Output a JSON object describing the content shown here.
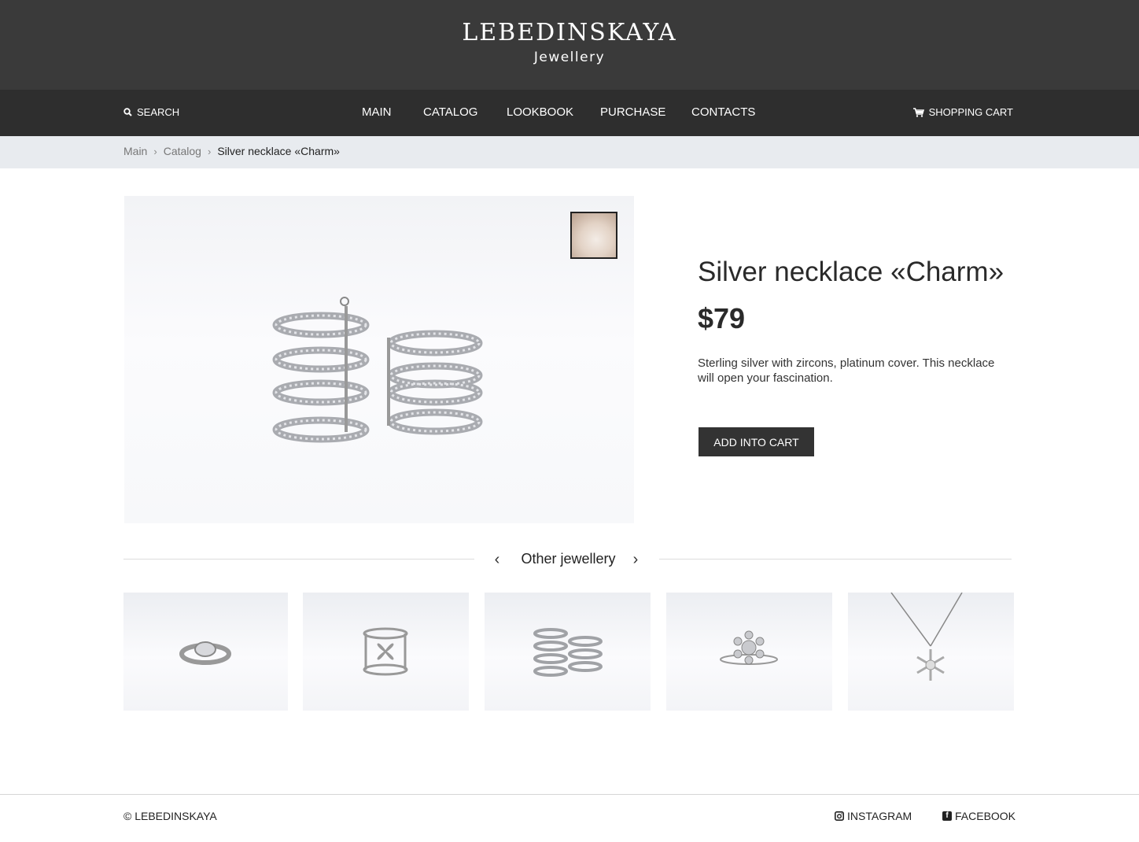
{
  "brand": {
    "title": "LEBEDINSKAYA",
    "subtitle": "Jewellery"
  },
  "nav": {
    "search_label": "SEARCH",
    "items": [
      "MAIN",
      "CATALOG",
      "LOOKBOOK",
      "PURCHASE",
      "CONTACTS"
    ],
    "cart_label": "SHOPPING CART"
  },
  "breadcrumbs": {
    "items": [
      "Main",
      "Catalog"
    ],
    "current": "Silver necklace «Charm»"
  },
  "product": {
    "title": "Silver necklace «Charm»",
    "price": "$79",
    "description": "Sterling silver with zircons, platinum cover. This necklace will open your fascination.",
    "add_button": "ADD INTO CART",
    "image_icon": "ring-image",
    "thumbnail_icon": "necklace-photo-thumbnail"
  },
  "other": {
    "title": "Other jewellery",
    "items": [
      "ring-solitaire",
      "ring-infinity",
      "ring-multi-band",
      "ring-snowflake",
      "necklace-snowflake"
    ]
  },
  "footer": {
    "copyright": "© LEBEDINSKAYA",
    "instagram": "INSTAGRAM",
    "facebook": "FACEBOOK"
  },
  "colors": {
    "header": "#3a3a3a",
    "navbar": "#2e2e2e",
    "breadcrumb_bg": "#e8ebef",
    "button": "#333333"
  }
}
